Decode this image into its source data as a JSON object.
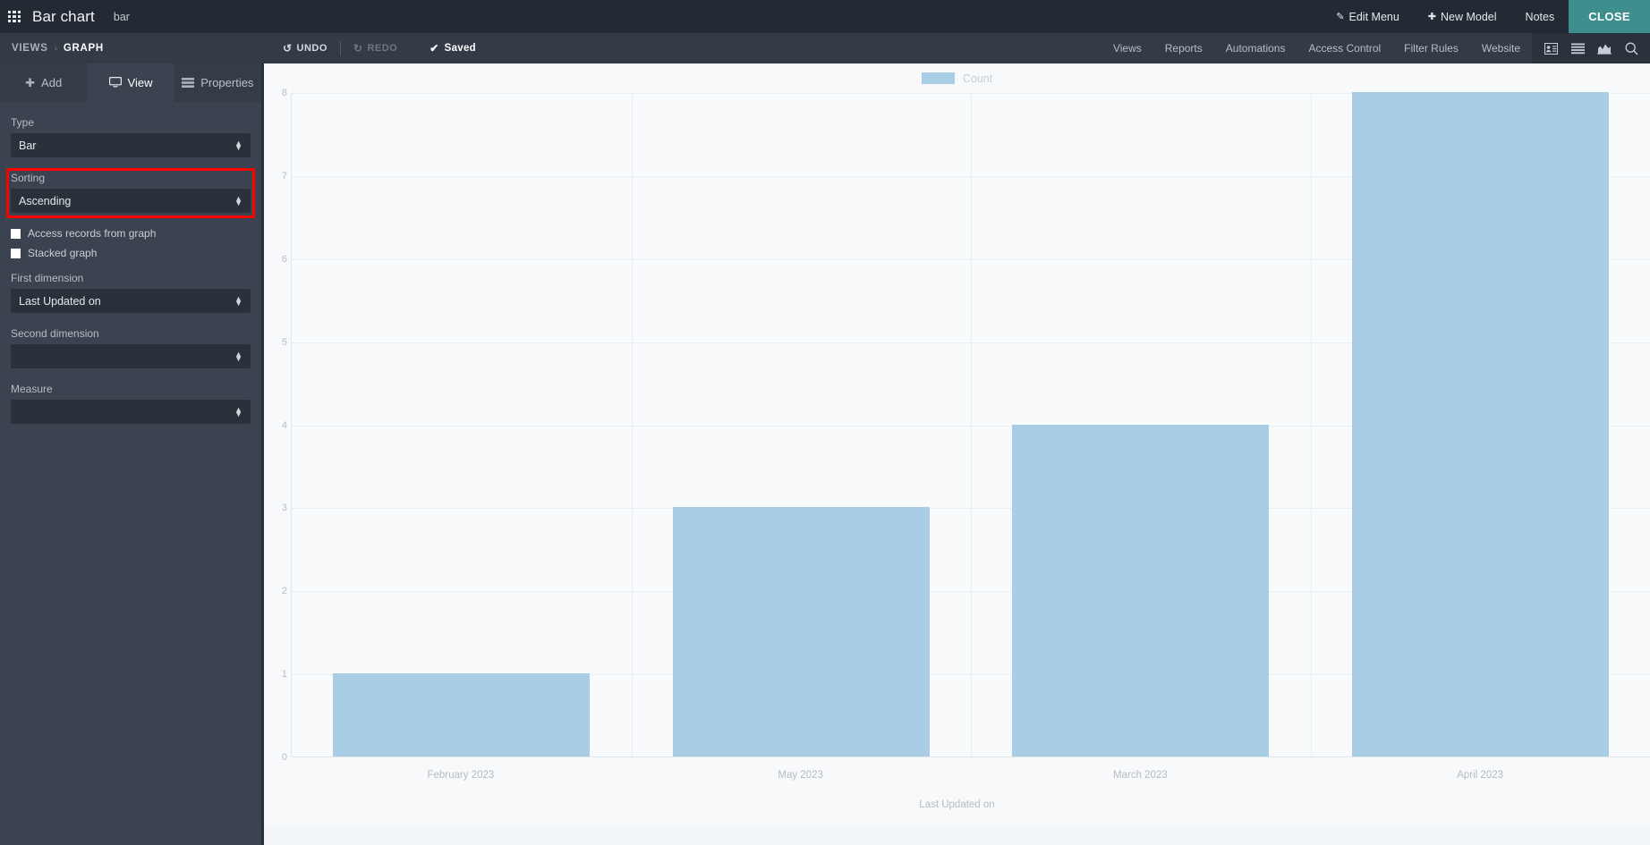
{
  "topbar": {
    "grid_icon": "apps-grid-icon",
    "title": "Bar chart",
    "subtitle": "bar",
    "edit_menu": "Edit Menu",
    "edit_menu_icon": "✎",
    "new_model": "New Model",
    "new_model_icon": "✚",
    "notes": "Notes",
    "close": "CLOSE",
    "close_color": "#3f8e8e"
  },
  "subbar": {
    "breadcrumb": {
      "root": "VIEWS",
      "separator": "›",
      "current": "GRAPH"
    },
    "undo": "UNDO",
    "undo_icon": "↺",
    "redo": "REDO",
    "redo_icon": "↻",
    "saved": "Saved",
    "saved_icon": "✔",
    "links": [
      "Views",
      "Reports",
      "Automations",
      "Access Control",
      "Filter Rules",
      "Website"
    ],
    "icons": [
      "contact-card-icon",
      "list-view-icon",
      "chart-view-icon",
      "search-icon"
    ]
  },
  "sidebar": {
    "tabs": [
      {
        "label": "Add",
        "icon": "plus-icon",
        "active": false
      },
      {
        "label": "View",
        "icon": "monitor-icon",
        "active": true
      },
      {
        "label": "Properties",
        "icon": "properties-icon",
        "active": false
      }
    ],
    "fields": [
      {
        "label": "Type",
        "value": "Bar"
      },
      {
        "label": "Sorting",
        "value": "Ascending",
        "highlighted": true
      },
      {
        "label": "First dimension",
        "value": "Last Updated on"
      },
      {
        "label": "Second dimension",
        "value": ""
      },
      {
        "label": "Measure",
        "value": ""
      }
    ],
    "checkboxes": [
      {
        "label": "Access records from graph",
        "checked": false
      },
      {
        "label": "Stacked graph",
        "checked": false
      }
    ],
    "highlight_color": "#ff0000"
  },
  "chart_data": {
    "type": "bar",
    "title": "",
    "categories": [
      "February 2023",
      "May 2023",
      "March 2023",
      "April 2023"
    ],
    "values": [
      1,
      3,
      4,
      8
    ],
    "series": [
      {
        "name": "Count",
        "values": [
          1,
          3,
          4,
          8
        ],
        "color": "#a8cde5"
      }
    ],
    "legend": [
      "Count"
    ],
    "legend_position": "top-center",
    "xlabel": "Last Updated on",
    "ylabel": "",
    "ylim": [
      0,
      8
    ],
    "yticks": [
      0,
      1,
      2,
      3,
      4,
      5,
      6,
      7,
      8
    ],
    "grid": true
  }
}
